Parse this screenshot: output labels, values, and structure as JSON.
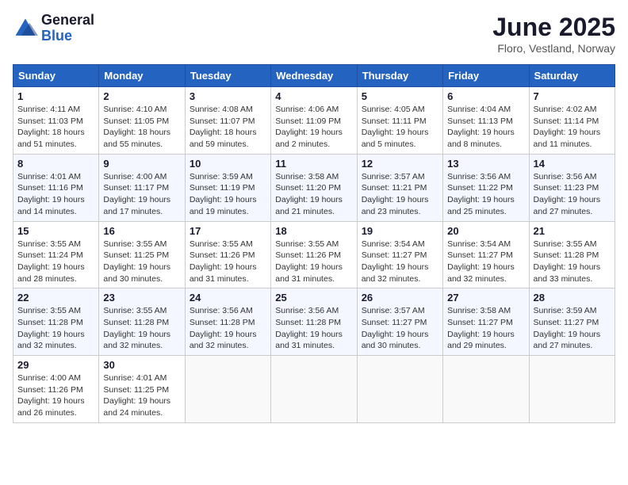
{
  "header": {
    "logo_general": "General",
    "logo_blue": "Blue",
    "month_title": "June 2025",
    "location": "Floro, Vestland, Norway"
  },
  "days_of_week": [
    "Sunday",
    "Monday",
    "Tuesday",
    "Wednesday",
    "Thursday",
    "Friday",
    "Saturday"
  ],
  "weeks": [
    [
      {
        "day": "1",
        "info": "Sunrise: 4:11 AM\nSunset: 11:03 PM\nDaylight: 18 hours\nand 51 minutes."
      },
      {
        "day": "2",
        "info": "Sunrise: 4:10 AM\nSunset: 11:05 PM\nDaylight: 18 hours\nand 55 minutes."
      },
      {
        "day": "3",
        "info": "Sunrise: 4:08 AM\nSunset: 11:07 PM\nDaylight: 18 hours\nand 59 minutes."
      },
      {
        "day": "4",
        "info": "Sunrise: 4:06 AM\nSunset: 11:09 PM\nDaylight: 19 hours\nand 2 minutes."
      },
      {
        "day": "5",
        "info": "Sunrise: 4:05 AM\nSunset: 11:11 PM\nDaylight: 19 hours\nand 5 minutes."
      },
      {
        "day": "6",
        "info": "Sunrise: 4:04 AM\nSunset: 11:13 PM\nDaylight: 19 hours\nand 8 minutes."
      },
      {
        "day": "7",
        "info": "Sunrise: 4:02 AM\nSunset: 11:14 PM\nDaylight: 19 hours\nand 11 minutes."
      }
    ],
    [
      {
        "day": "8",
        "info": "Sunrise: 4:01 AM\nSunset: 11:16 PM\nDaylight: 19 hours\nand 14 minutes."
      },
      {
        "day": "9",
        "info": "Sunrise: 4:00 AM\nSunset: 11:17 PM\nDaylight: 19 hours\nand 17 minutes."
      },
      {
        "day": "10",
        "info": "Sunrise: 3:59 AM\nSunset: 11:19 PM\nDaylight: 19 hours\nand 19 minutes."
      },
      {
        "day": "11",
        "info": "Sunrise: 3:58 AM\nSunset: 11:20 PM\nDaylight: 19 hours\nand 21 minutes."
      },
      {
        "day": "12",
        "info": "Sunrise: 3:57 AM\nSunset: 11:21 PM\nDaylight: 19 hours\nand 23 minutes."
      },
      {
        "day": "13",
        "info": "Sunrise: 3:56 AM\nSunset: 11:22 PM\nDaylight: 19 hours\nand 25 minutes."
      },
      {
        "day": "14",
        "info": "Sunrise: 3:56 AM\nSunset: 11:23 PM\nDaylight: 19 hours\nand 27 minutes."
      }
    ],
    [
      {
        "day": "15",
        "info": "Sunrise: 3:55 AM\nSunset: 11:24 PM\nDaylight: 19 hours\nand 28 minutes."
      },
      {
        "day": "16",
        "info": "Sunrise: 3:55 AM\nSunset: 11:25 PM\nDaylight: 19 hours\nand 30 minutes."
      },
      {
        "day": "17",
        "info": "Sunrise: 3:55 AM\nSunset: 11:26 PM\nDaylight: 19 hours\nand 31 minutes."
      },
      {
        "day": "18",
        "info": "Sunrise: 3:55 AM\nSunset: 11:26 PM\nDaylight: 19 hours\nand 31 minutes."
      },
      {
        "day": "19",
        "info": "Sunrise: 3:54 AM\nSunset: 11:27 PM\nDaylight: 19 hours\nand 32 minutes."
      },
      {
        "day": "20",
        "info": "Sunrise: 3:54 AM\nSunset: 11:27 PM\nDaylight: 19 hours\nand 32 minutes."
      },
      {
        "day": "21",
        "info": "Sunrise: 3:55 AM\nSunset: 11:28 PM\nDaylight: 19 hours\nand 33 minutes."
      }
    ],
    [
      {
        "day": "22",
        "info": "Sunrise: 3:55 AM\nSunset: 11:28 PM\nDaylight: 19 hours\nand 32 minutes."
      },
      {
        "day": "23",
        "info": "Sunrise: 3:55 AM\nSunset: 11:28 PM\nDaylight: 19 hours\nand 32 minutes."
      },
      {
        "day": "24",
        "info": "Sunrise: 3:56 AM\nSunset: 11:28 PM\nDaylight: 19 hours\nand 32 minutes."
      },
      {
        "day": "25",
        "info": "Sunrise: 3:56 AM\nSunset: 11:28 PM\nDaylight: 19 hours\nand 31 minutes."
      },
      {
        "day": "26",
        "info": "Sunrise: 3:57 AM\nSunset: 11:27 PM\nDaylight: 19 hours\nand 30 minutes."
      },
      {
        "day": "27",
        "info": "Sunrise: 3:58 AM\nSunset: 11:27 PM\nDaylight: 19 hours\nand 29 minutes."
      },
      {
        "day": "28",
        "info": "Sunrise: 3:59 AM\nSunset: 11:27 PM\nDaylight: 19 hours\nand 27 minutes."
      }
    ],
    [
      {
        "day": "29",
        "info": "Sunrise: 4:00 AM\nSunset: 11:26 PM\nDaylight: 19 hours\nand 26 minutes."
      },
      {
        "day": "30",
        "info": "Sunrise: 4:01 AM\nSunset: 11:25 PM\nDaylight: 19 hours\nand 24 minutes."
      },
      null,
      null,
      null,
      null,
      null
    ]
  ]
}
